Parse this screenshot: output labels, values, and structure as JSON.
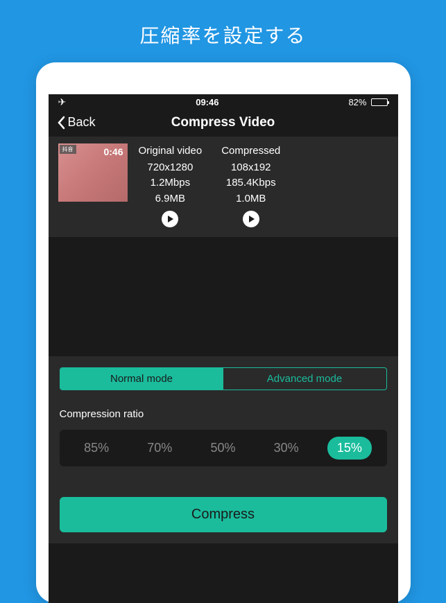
{
  "page_heading": "圧縮率を設定する",
  "status": {
    "time": "09:46",
    "battery_percent": "82%"
  },
  "nav": {
    "back_label": "Back",
    "title": "Compress Video"
  },
  "thumbnail": {
    "badge": "抖音",
    "duration": "0:46"
  },
  "video_info": {
    "original": {
      "header": "Original video",
      "resolution": "720x1280",
      "bitrate": "1.2Mbps",
      "filesize": "6.9MB"
    },
    "compressed": {
      "header": "Compressed",
      "resolution": "108x192",
      "bitrate": "185.4Kbps",
      "filesize": "1.0MB"
    }
  },
  "modes": {
    "normal": "Normal mode",
    "advanced": "Advanced mode",
    "selected": "normal"
  },
  "ratio": {
    "label": "Compression ratio",
    "options": [
      "85%",
      "70%",
      "50%",
      "30%",
      "15%"
    ],
    "selected": "15%"
  },
  "compress_button": "Compress"
}
